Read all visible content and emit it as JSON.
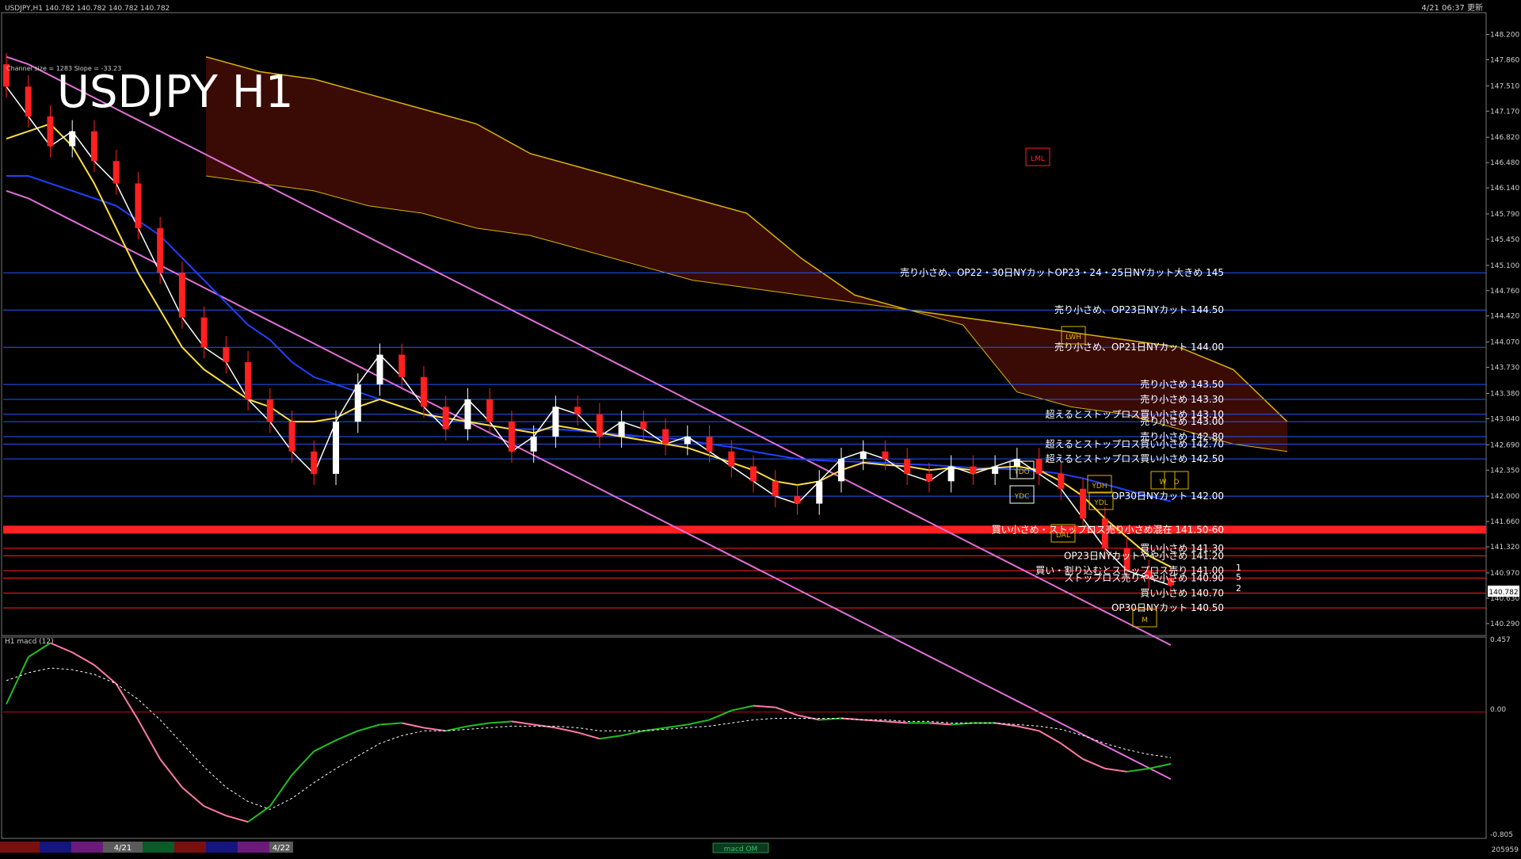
{
  "window": {
    "header_info": "USDJPY,H1  140.782 140.782 140.782 140.782",
    "update_time": "4/21 06:37 更新"
  },
  "main_panel": {
    "title": "USDJPY H1",
    "channel_info": "Channel size = 1283 Slope = -33.23",
    "last_price_tag": "140.782",
    "tick_labels": [
      "148.200",
      "147.860",
      "147.510",
      "147.170",
      "146.820",
      "146.480",
      "146.140",
      "145.790",
      "145.450",
      "145.100",
      "144.760",
      "144.420",
      "144.070",
      "143.730",
      "143.380",
      "143.040",
      "142.690",
      "142.350",
      "142.000",
      "141.660",
      "141.320",
      "140.970",
      "140.630",
      "140.290"
    ],
    "markers": [
      {
        "text": "LML"
      },
      {
        "text": "LWH"
      },
      {
        "text": "YDO"
      },
      {
        "text": "YDC"
      },
      {
        "text": "YDH"
      },
      {
        "text": "YDL"
      },
      {
        "text": "DAL"
      },
      {
        "text": "W"
      },
      {
        "text": "D"
      },
      {
        "text": "M"
      }
    ],
    "side_numbers": [
      "1",
      "5",
      "2"
    ],
    "levels": [
      {
        "price": 145.0,
        "text": "売り小さめ、OP22・30日NYカットOP23・24・25日NYカット大きめ 145",
        "color": "#1e5aff"
      },
      {
        "price": 144.5,
        "text": "売り小さめ、OP23日NYカット 144.50",
        "color": "#1e5aff"
      },
      {
        "price": 144.0,
        "text": "売り小さめ、OP21日NYカット 144.00",
        "color": "#1e5aff"
      },
      {
        "price": 143.5,
        "text": "売り小さめ 143.50",
        "color": "#1e5aff"
      },
      {
        "price": 143.3,
        "text": "売り小さめ 143.30",
        "color": "#1e5aff"
      },
      {
        "price": 143.1,
        "text": "超えるとストップロス買い小さめ 143.10",
        "color": "#1e5aff"
      },
      {
        "price": 143.0,
        "text": "売り小さめ 143.00",
        "color": "#1e5aff"
      },
      {
        "price": 142.8,
        "text": "売り小さめ 142.80",
        "color": "#1e5aff"
      },
      {
        "price": 142.7,
        "text": "超えるとストップロス買い小さめ 142.70",
        "color": "#1e5aff"
      },
      {
        "price": 142.5,
        "text": "超えるとストップロス買い小さめ 142.50",
        "color": "#1e5aff"
      },
      {
        "price": 142.0,
        "text": "OP30日NYカット 142.00",
        "color": "#1e5aff"
      },
      {
        "price": 141.55,
        "text": "買い小さめ・ストップロス売り小さめ混在 141.50-60",
        "color": "#ff2020"
      },
      {
        "price": 141.3,
        "text": "買い小さめ 141.30",
        "color": "#ff2020"
      },
      {
        "price": 141.2,
        "text": "OP23日NYカットやや小さめ 141.20",
        "color": "#ff2020"
      },
      {
        "price": 141.0,
        "text": "買い・割り込むとストップロス売り 141.00",
        "color": "#ff2020"
      },
      {
        "price": 140.9,
        "text": "ストップロス売りやや小さめ 140.90",
        "color": "#ff2020"
      },
      {
        "price": 140.7,
        "text": "買い小さめ 140.70",
        "color": "#ff2020"
      },
      {
        "price": 140.5,
        "text": "OP30日NYカット 140.50",
        "color": "#ff2020"
      }
    ]
  },
  "sub_panel": {
    "title": "H1 macd (12)",
    "tick_labels": [
      "0.457",
      "0.00",
      "-0.805"
    ]
  },
  "bottom_bar": {
    "date_labels": [
      "4/21",
      "4/22"
    ],
    "indicator_tab": "macd OM",
    "counter": "205959"
  },
  "chart_data": [
    {
      "type": "candlestick",
      "title": "USDJPY H1",
      "ylim": [
        140.15,
        148.45
      ],
      "y_ticks": [
        148.2,
        147.86,
        147.51,
        147.17,
        146.82,
        146.48,
        146.14,
        145.79,
        145.45,
        145.1,
        144.76,
        144.42,
        144.07,
        143.73,
        143.38,
        143.04,
        142.69,
        142.35,
        142.0,
        141.66,
        141.32,
        140.97,
        140.63,
        140.29
      ],
      "x_labels": [
        "4/21",
        "4/22"
      ],
      "last_price": 140.782,
      "series": [
        {
          "name": "close",
          "values": [
            147.5,
            147.1,
            146.7,
            146.9,
            146.5,
            146.2,
            145.6,
            145.0,
            144.4,
            144.0,
            143.8,
            143.3,
            143.0,
            142.6,
            142.3,
            143.0,
            143.5,
            143.9,
            143.6,
            143.2,
            142.9,
            143.3,
            143.0,
            142.6,
            142.8,
            143.2,
            143.1,
            142.8,
            143.0,
            142.9,
            142.7,
            142.8,
            142.6,
            142.4,
            142.2,
            142.0,
            141.9,
            142.2,
            142.5,
            142.6,
            142.5,
            142.3,
            142.2,
            142.4,
            142.3,
            142.4,
            142.5,
            142.3,
            142.1,
            141.7,
            141.3,
            141.0,
            140.9,
            140.8
          ]
        },
        {
          "name": "EMA",
          "values": [
            146.3,
            146.3,
            146.2,
            146.1,
            146.0,
            145.9,
            145.7,
            145.5,
            145.2,
            144.9,
            144.6,
            144.3,
            144.1,
            143.8,
            143.6,
            143.5,
            143.4,
            143.3,
            143.2,
            143.1,
            143.0,
            143.0,
            142.95,
            142.9,
            142.9,
            142.9,
            142.88,
            142.85,
            142.83,
            142.8,
            142.78,
            142.75,
            142.7,
            142.66,
            142.6,
            142.55,
            142.5,
            142.48,
            142.47,
            142.46,
            142.45,
            142.43,
            142.42,
            142.4,
            142.38,
            142.37,
            142.36,
            142.34,
            142.3,
            142.24,
            142.16,
            142.08,
            142.0,
            141.93
          ]
        },
        {
          "name": "SMA",
          "values": [
            146.8,
            146.9,
            147.0,
            146.7,
            146.2,
            145.6,
            145.0,
            144.5,
            144.0,
            143.7,
            143.5,
            143.3,
            143.2,
            143.0,
            143.0,
            143.05,
            143.2,
            143.3,
            143.2,
            143.1,
            143.05,
            143.0,
            142.95,
            142.9,
            142.85,
            142.95,
            142.9,
            142.85,
            142.8,
            142.75,
            142.7,
            142.65,
            142.55,
            142.45,
            142.35,
            142.2,
            142.15,
            142.2,
            142.35,
            142.45,
            142.42,
            142.4,
            142.35,
            142.38,
            142.35,
            142.38,
            142.4,
            142.35,
            142.2,
            142.0,
            141.7,
            141.45,
            141.2,
            141.05
          ]
        },
        {
          "name": "Channel",
          "values": [
            147.0,
            146.9,
            146.75,
            146.6,
            146.45,
            146.3,
            146.15,
            146.0,
            145.85,
            145.7,
            145.55,
            145.4,
            145.25,
            145.1,
            144.95,
            144.8,
            144.65,
            144.5,
            144.35,
            144.2,
            144.05,
            143.9,
            143.75,
            143.6,
            143.45,
            143.3,
            143.15,
            143.0,
            142.85,
            142.7,
            142.55,
            142.4,
            142.25,
            142.1,
            141.95,
            141.8,
            141.65,
            141.5,
            141.35,
            141.2,
            141.05,
            140.9,
            140.75,
            140.6,
            140.45,
            140.3,
            140.15,
            140.0,
            139.85,
            139.7,
            139.55,
            139.4,
            139.25,
            139.1
          ]
        }
      ]
    },
    {
      "type": "line",
      "title": "H1 macd (12)",
      "ylim": [
        -0.805,
        0.457
      ],
      "series": [
        {
          "name": "macd",
          "values": [
            0.05,
            0.35,
            0.44,
            0.38,
            0.3,
            0.18,
            -0.05,
            -0.3,
            -0.48,
            -0.6,
            -0.66,
            -0.7,
            -0.6,
            -0.4,
            -0.25,
            -0.18,
            -0.12,
            -0.08,
            -0.07,
            -0.1,
            -0.12,
            -0.09,
            -0.07,
            -0.06,
            -0.08,
            -0.1,
            -0.13,
            -0.17,
            -0.15,
            -0.12,
            -0.1,
            -0.08,
            -0.05,
            0.01,
            0.04,
            0.03,
            -0.02,
            -0.05,
            -0.04,
            -0.05,
            -0.06,
            -0.07,
            -0.07,
            -0.08,
            -0.07,
            -0.07,
            -0.09,
            -0.12,
            -0.2,
            -0.3,
            -0.36,
            -0.38,
            -0.36,
            -0.33
          ]
        },
        {
          "name": "signal",
          "values": [
            0.2,
            0.25,
            0.28,
            0.27,
            0.24,
            0.18,
            0.08,
            -0.05,
            -0.2,
            -0.35,
            -0.48,
            -0.57,
            -0.62,
            -0.55,
            -0.45,
            -0.36,
            -0.28,
            -0.2,
            -0.15,
            -0.12,
            -0.12,
            -0.11,
            -0.1,
            -0.09,
            -0.09,
            -0.09,
            -0.1,
            -0.12,
            -0.12,
            -0.12,
            -0.11,
            -0.1,
            -0.09,
            -0.07,
            -0.05,
            -0.04,
            -0.04,
            -0.04,
            -0.04,
            -0.05,
            -0.05,
            -0.06,
            -0.06,
            -0.07,
            -0.07,
            -0.07,
            -0.08,
            -0.09,
            -0.11,
            -0.15,
            -0.2,
            -0.24,
            -0.27,
            -0.29
          ]
        }
      ]
    }
  ]
}
